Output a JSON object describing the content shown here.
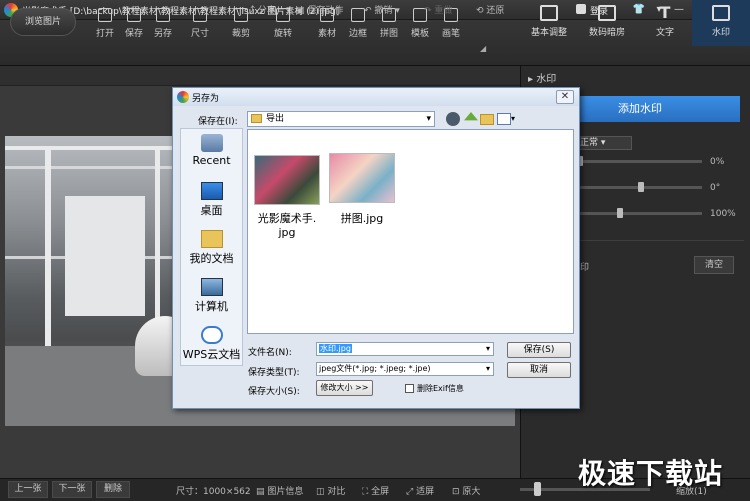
{
  "window": {
    "title": "光影魔术手 [D:\\backup\\教程素材\\教程素材\\教程素材\\jisuxz 图片素材 (2).jpg]",
    "login_label": "登录",
    "controls": [
      "👕",
      "▾",
      "—",
      "☐",
      "✕"
    ]
  },
  "toolbar": {
    "browse_label": "浏览图片",
    "tools": [
      "打开",
      "保存",
      "另存",
      "尺寸",
      "裁剪",
      "旋转",
      "素材",
      "边框",
      "拼图",
      "模板",
      "画笔"
    ],
    "right_tabs": [
      "基本调整",
      "数码暗房",
      "文字",
      "水印"
    ],
    "active_tab": "水印"
  },
  "subbar": {
    "share": "分享",
    "save_action": "保存动作",
    "undo": "撤销",
    "redo": "重做",
    "restore": "还原"
  },
  "right_panel": {
    "section_title": "水印",
    "add_watermark": "添加水印",
    "blend_mode": "正常",
    "opacity_value": "0%",
    "rotate_value": "0°",
    "scale_value": "100%",
    "opacity": 0.0,
    "rotate": 0.5,
    "scale": 0.33,
    "layer_label": "印",
    "clear_label": "清空"
  },
  "statusbar": {
    "prev": "上一张",
    "next": "下一张",
    "delete": "删除",
    "size_text": "尺寸：1000×562",
    "info": "图片信息",
    "compare": "对比",
    "fullscreen": "全屏",
    "fit": "适屏",
    "original": "原大",
    "zoom": "缩放(1)",
    "zoom_level": 0.13
  },
  "brand_mark": "极速下载站",
  "dialog": {
    "title": "另存为",
    "save_in_label": "保存在(I):",
    "save_in_value": "导出",
    "places": [
      "Recent",
      "桌面",
      "我的文档",
      "计算机",
      "WPS云文档"
    ],
    "files": [
      {
        "name_line1": "光影魔术手.",
        "name_line2": "jpg"
      },
      {
        "name_line1": "拼图.jpg",
        "name_line2": ""
      }
    ],
    "filename_label": "文件名(N):",
    "filename_value": "水印.jpg",
    "filetype_label": "保存类型(T):",
    "filetype_value": "jpeg文件(*.jpg; *.jpeg; *.jpe)",
    "filesize_label": "保存大小(S):",
    "modify_size_label": "修改大小 >>",
    "exif_label": "删除Exif信息",
    "save_button": "保存(S)",
    "cancel_button": "取消"
  }
}
